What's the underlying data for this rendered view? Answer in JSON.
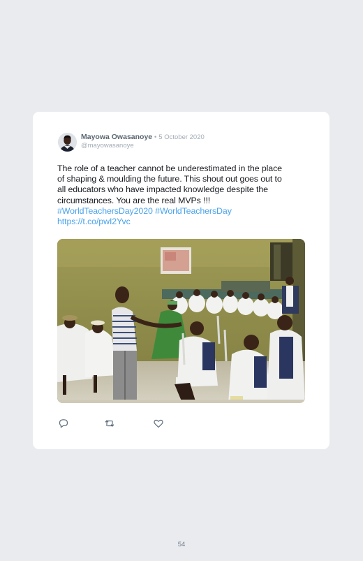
{
  "post": {
    "author_name": "Mayowa Owasanoye",
    "separator": "•",
    "date": "5 October 2020",
    "handle": "@mayowasanoye",
    "text_lines": [
      "The role of a teacher cannot be underestimated in the place",
      "of shaping & moulding the future. This shout out goes out to",
      "all educators who have impacted knowledge despite the",
      "circumstances. You are the real MVPs !!!"
    ],
    "hashtag_1": "#WorldTeachersDay2020",
    "hashtag_2": "#WorldTeachersDay",
    "link": "https://t.co/pwI2Yvc",
    "actions": {
      "reply_icon": "reply-icon",
      "retweet_icon": "retweet-icon",
      "like_icon": "heart-icon"
    }
  },
  "page_number": "54",
  "colors": {
    "background": "#e9ebee",
    "card": "#ffffff",
    "link": "#4aa3ec",
    "author": "#5b6670",
    "muted": "#a3acb6"
  }
}
